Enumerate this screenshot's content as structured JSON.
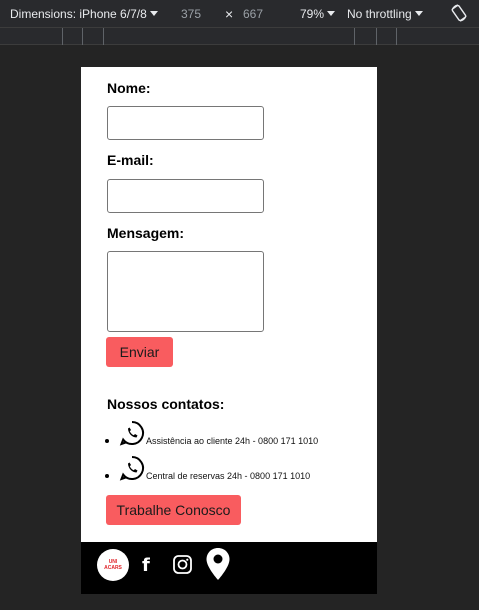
{
  "toolbar": {
    "dimensions_label": "Dimensions: iPhone 6/7/8",
    "width": "375",
    "times": "×",
    "height": "667",
    "zoom": "79%",
    "throttling": "No throttling"
  },
  "form": {
    "name_label": "Nome:",
    "email_label": "E-mail:",
    "message_label": "Mensagem:",
    "submit_label": "Enviar"
  },
  "contacts": {
    "heading": "Nossos contatos:",
    "items": [
      {
        "text": "Assistência ao cliente 24h - 0800 171 1010",
        "icon": "whatsapp-icon"
      },
      {
        "text": "Central de reservas 24h - 0800 171 1010",
        "icon": "whatsapp-icon"
      }
    ],
    "work_button": "Trabalhe Conosco"
  },
  "footer": {
    "logo_line1": "UNI",
    "logo_line2": "ACARS",
    "facebook_glyph": "f"
  },
  "colors": {
    "accent": "#f95c5f",
    "footer_bg": "#000000"
  }
}
